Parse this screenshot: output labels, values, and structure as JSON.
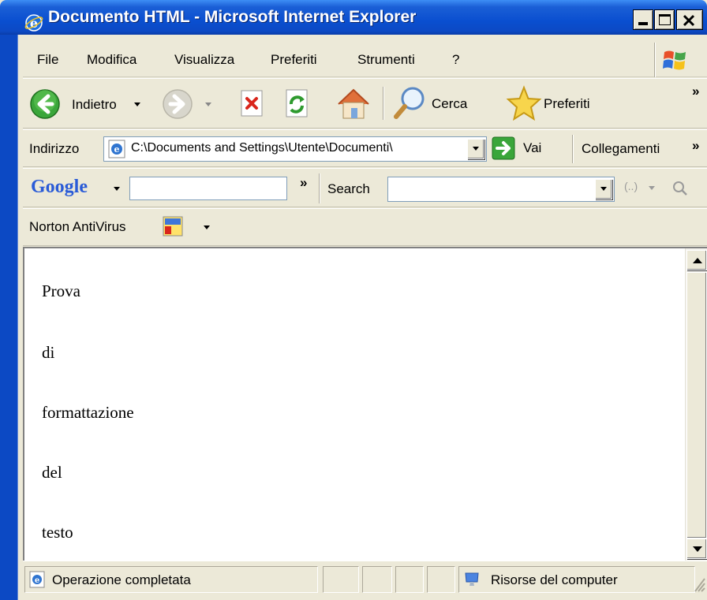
{
  "window": {
    "title": "Documento HTML - Microsoft Internet Explorer"
  },
  "menu": [
    "File",
    "Modifica",
    "Visualizza",
    "Preferiti",
    "Strumenti",
    "?"
  ],
  "toolbar": {
    "back_label": "Indietro",
    "search_label": "Cerca",
    "favorites_label": "Preferiti",
    "more_glyph": "»"
  },
  "address": {
    "label": "Indirizzo",
    "value": "C:\\Documents and Settings\\Utente\\Documenti\\",
    "go_label": "Vai",
    "links_label": "Collegamenti",
    "more_glyph": "»"
  },
  "google": {
    "logo_text": "Google",
    "chevron": "»",
    "search_label": "Search",
    "search_value": "",
    "query_value": "",
    "paren_glyph": "(..)"
  },
  "norton": {
    "label": "Norton AntiVirus"
  },
  "content": {
    "lines": [
      "Prova",
      "di",
      "formattazione",
      "del",
      "testo"
    ]
  },
  "status": {
    "text": "Operazione completata",
    "zone": "Risorse del computer"
  },
  "colors": {
    "titlebar": "#0a4fd0",
    "chrome": "#ece9d8"
  }
}
